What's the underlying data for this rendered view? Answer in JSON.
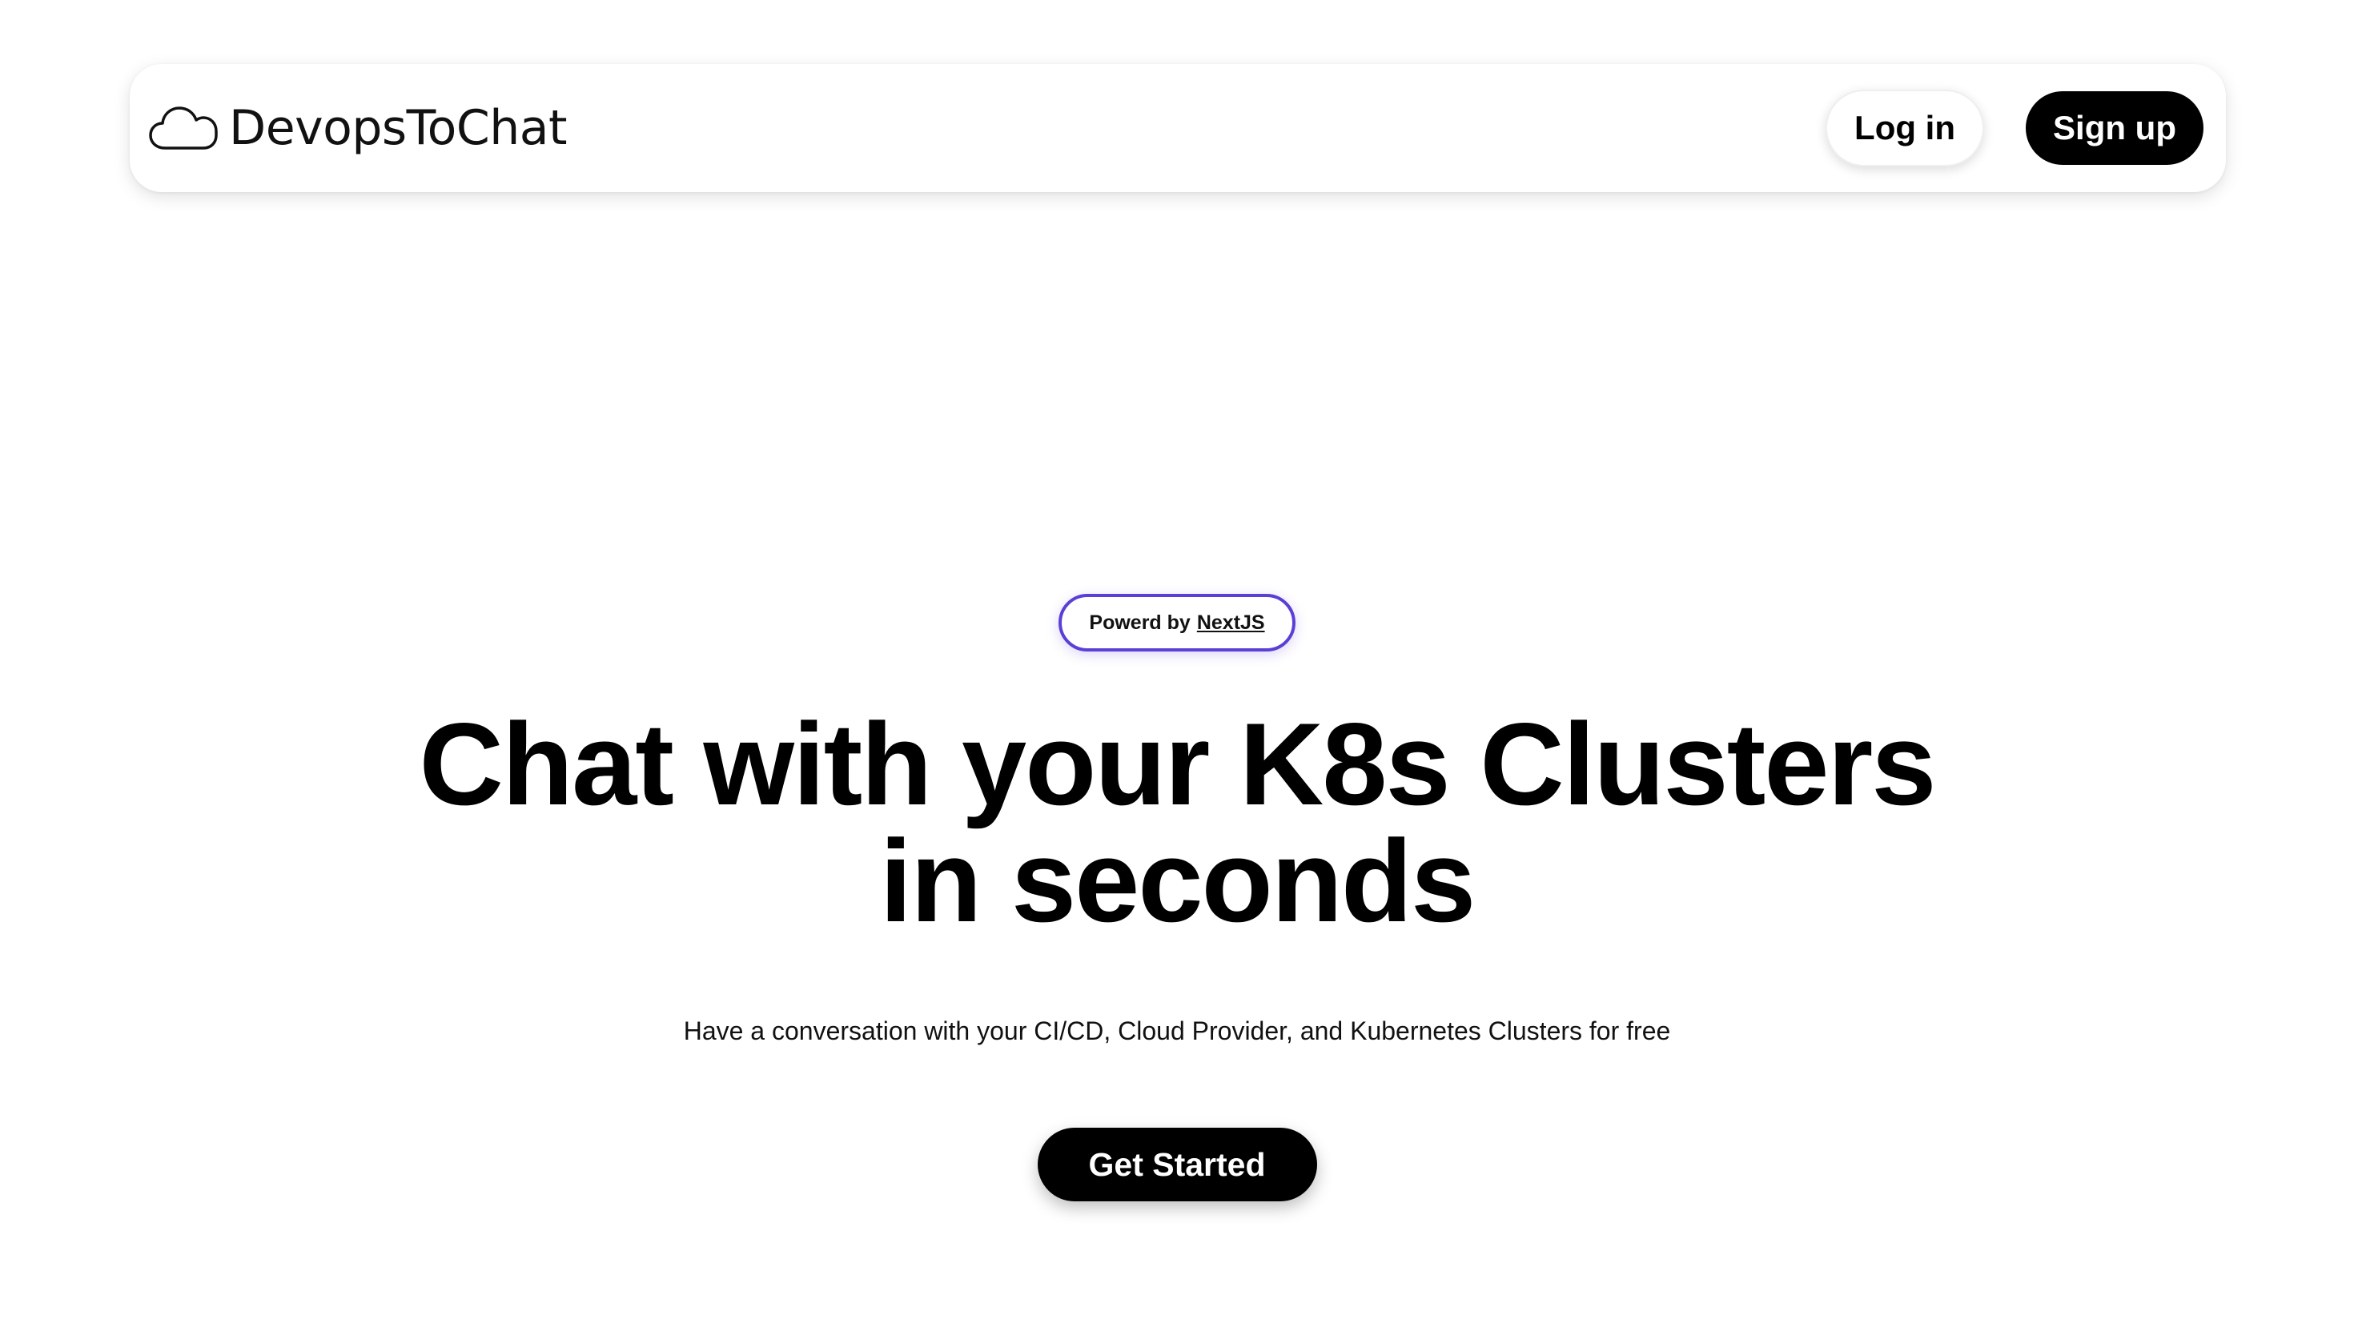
{
  "navbar": {
    "brand_name": "DevopsToChat",
    "brand_icon": "cloud-icon",
    "login_label": "Log in",
    "signup_label": "Sign up"
  },
  "hero": {
    "badge_prefix": "Powerd by",
    "badge_link": "NextJS",
    "headline_line1": "Chat with your K8s Clusters",
    "headline_line2": "in seconds",
    "subtitle": "Have a conversation with your CI/CD, Cloud Provider, and Kubernetes Clusters for free",
    "cta_label": "Get Started"
  },
  "colors": {
    "background": "#ffffff",
    "text": "#000000",
    "badge_border": "#5b3fd6",
    "primary_button": "#000000"
  }
}
